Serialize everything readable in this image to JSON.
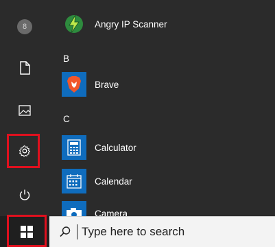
{
  "rail": {
    "items": [
      {
        "icon": "user-avatar-icon",
        "label": "User"
      },
      {
        "icon": "document-icon",
        "label": "Documents"
      },
      {
        "icon": "pictures-icon",
        "label": "Pictures"
      },
      {
        "icon": "settings-gear-icon",
        "label": "Settings"
      },
      {
        "icon": "power-icon",
        "label": "Power"
      }
    ],
    "avatar_letter": "8"
  },
  "apps": {
    "items": [
      {
        "label": "Angry IP Scanner",
        "icon": "angry-ip-scanner-icon"
      },
      {
        "label": "Brave",
        "icon": "brave-icon"
      },
      {
        "label": "Calculator",
        "icon": "calculator-icon"
      },
      {
        "label": "Calendar",
        "icon": "calendar-icon"
      },
      {
        "label": "Camera",
        "icon": "camera-icon"
      }
    ],
    "letters": [
      "B",
      "C"
    ]
  },
  "search": {
    "placeholder": "Type here to search"
  },
  "colors": {
    "highlight": "#e0101e",
    "tile_blue": "#0f6cbd",
    "brave_orange": "#f1562b"
  }
}
